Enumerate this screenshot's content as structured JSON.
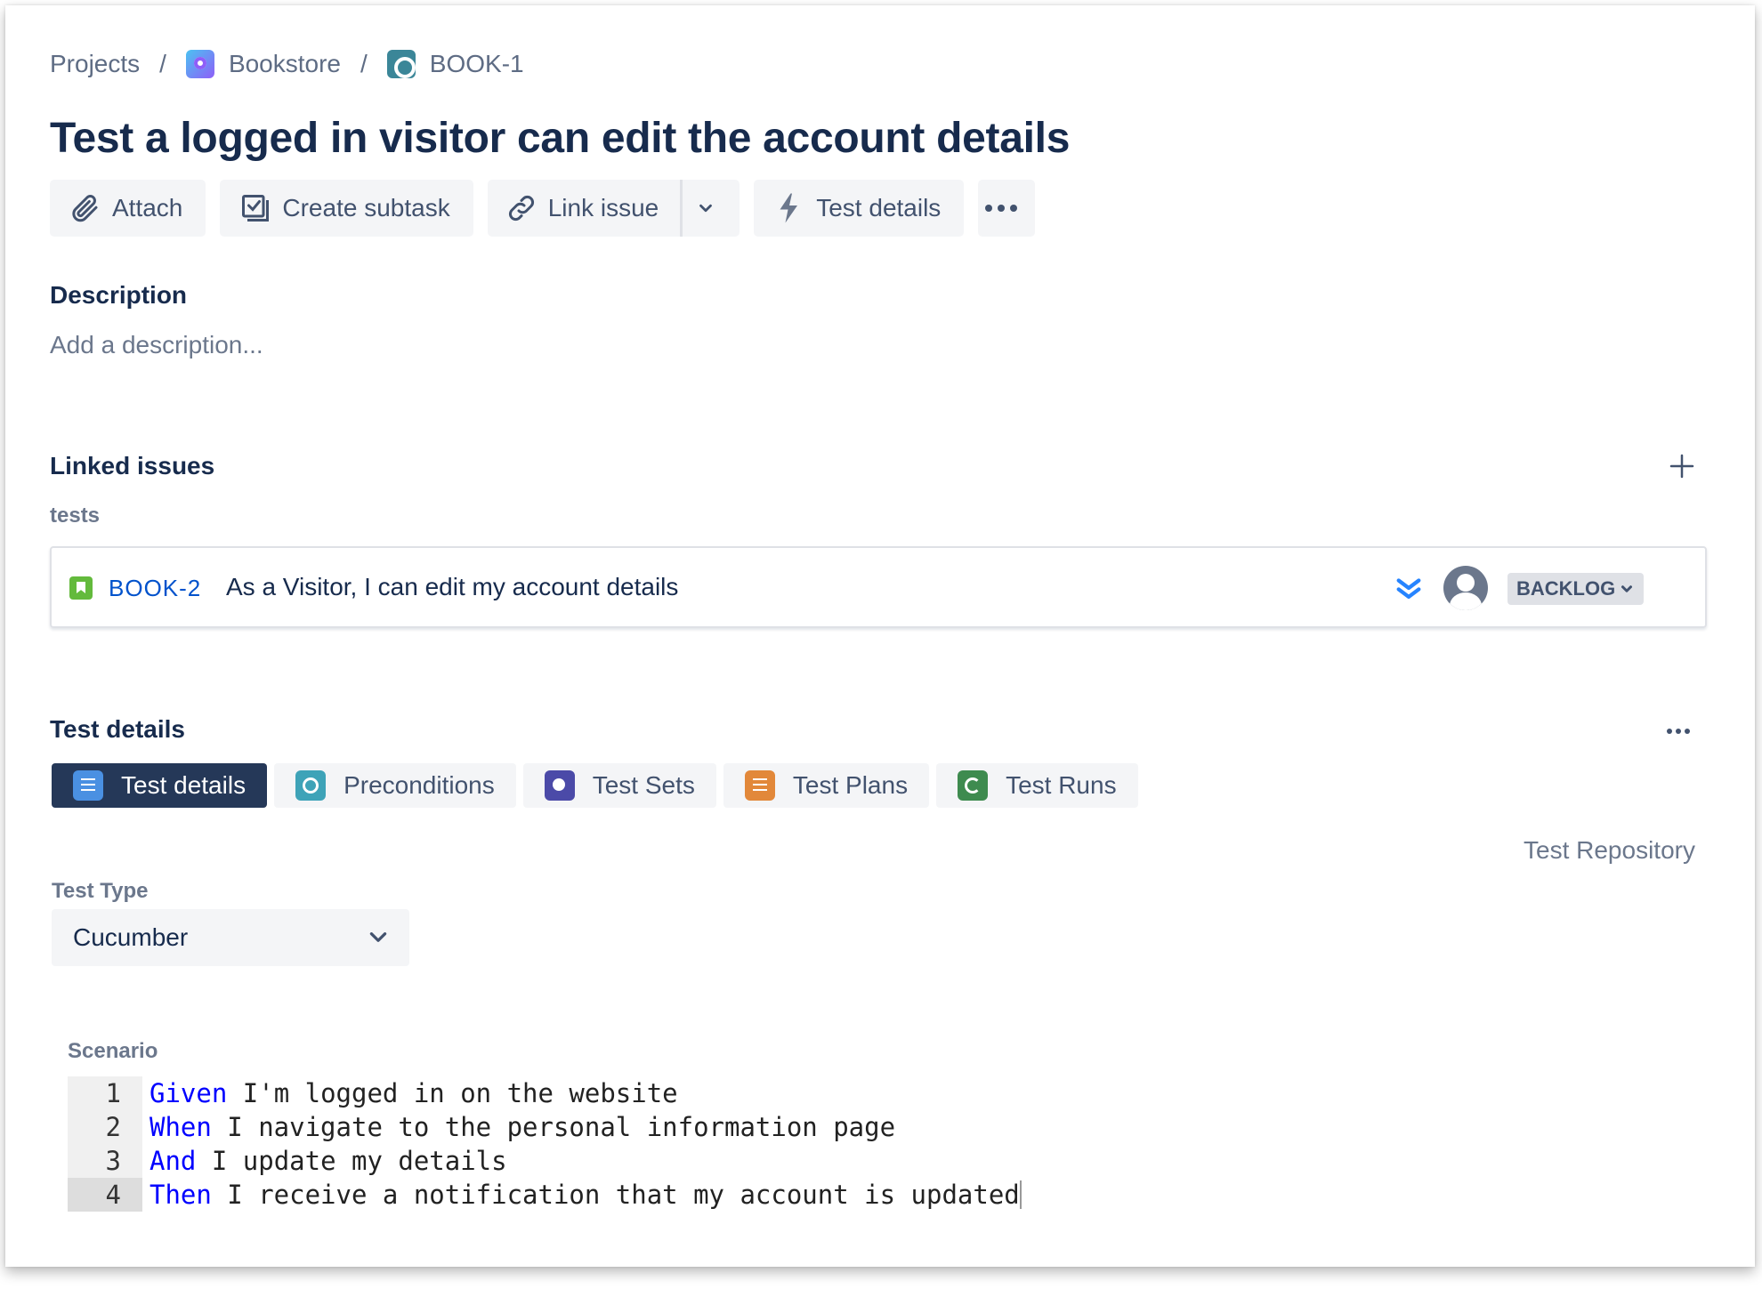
{
  "breadcrumb": {
    "projects": "Projects",
    "separator": "/",
    "project": "Bookstore",
    "issue": "BOOK-1"
  },
  "issue_title": "Test a logged in visitor can edit the account details",
  "toolbar": {
    "attach": "Attach",
    "create_subtask": "Create subtask",
    "link_issue": "Link issue",
    "test_details": "Test details"
  },
  "description": {
    "heading": "Description",
    "placeholder": "Add a description..."
  },
  "linked_issues": {
    "heading": "Linked issues",
    "relation": "tests",
    "items": [
      {
        "key": "BOOK-2",
        "summary": "As a Visitor, I can edit my account details",
        "status": "BACKLOG",
        "priority_icon": "lowest-priority-icon",
        "type_icon": "story-icon"
      }
    ]
  },
  "test_details": {
    "heading": "Test details",
    "tabs": [
      {
        "label": "Test details",
        "active": true
      },
      {
        "label": "Preconditions",
        "active": false
      },
      {
        "label": "Test Sets",
        "active": false
      },
      {
        "label": "Test Plans",
        "active": false
      },
      {
        "label": "Test Runs",
        "active": false
      }
    ],
    "repository_link": "Test Repository",
    "test_type_label": "Test Type",
    "test_type_value": "Cucumber",
    "scenario_label": "Scenario",
    "scenario_lines": [
      {
        "num": "1",
        "keyword": "Given",
        "text": " I'm logged in on the website"
      },
      {
        "num": "2",
        "keyword": "When",
        "text": " I navigate to the personal information page"
      },
      {
        "num": "3",
        "keyword": "And",
        "text": " I update my details"
      },
      {
        "num": "4",
        "keyword": "Then",
        "text": " I receive a notification that my account is updated"
      }
    ]
  },
  "colors": {
    "accent": "#0052cc",
    "title_text": "#172b4d",
    "muted_text": "#6b778c",
    "active_tab_bg": "#253858",
    "gherkin_keyword": "#0000ff",
    "story_green": "#63ba3c"
  }
}
